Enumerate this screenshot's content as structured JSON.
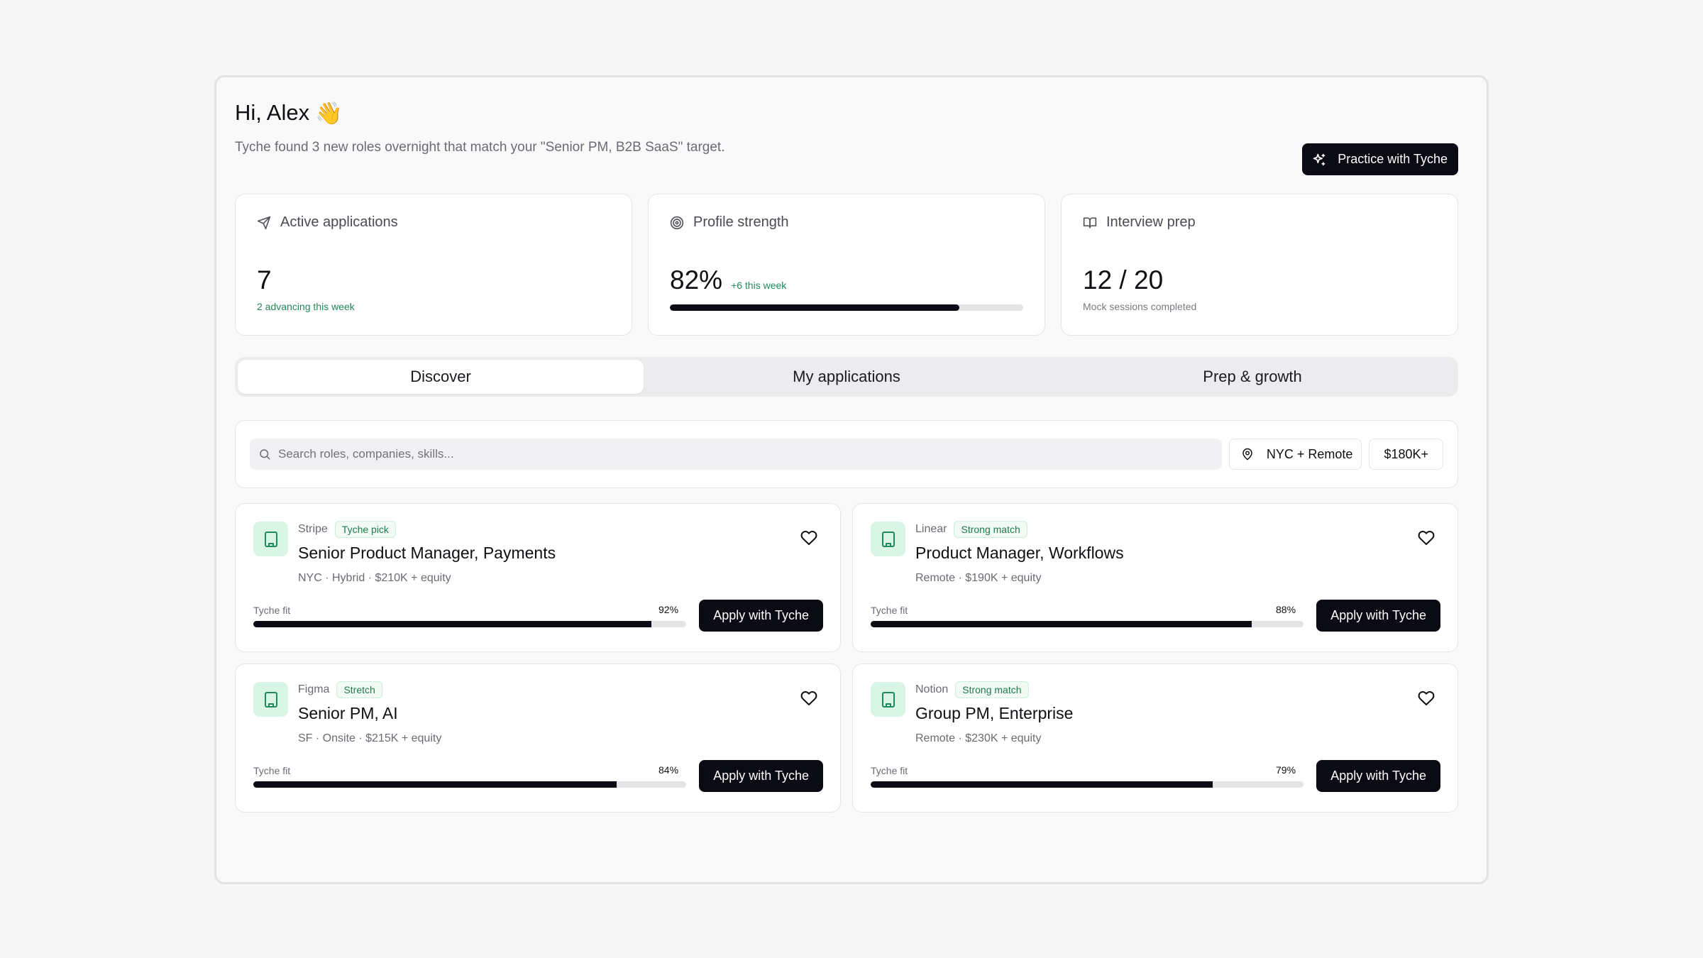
{
  "header": {
    "greeting": "Hi, Alex",
    "greeting_emoji": "👋",
    "subtitle": "Tyche found 3 new roles overnight that match your \"Senior PM, B2B SaaS\" target.",
    "practice_label": "Practice with Tyche"
  },
  "stats": [
    {
      "icon": "send-icon",
      "label": "Active applications",
      "value": "7",
      "note": "2 advancing this week"
    },
    {
      "icon": "target-icon",
      "label": "Profile strength",
      "value": "82%",
      "delta": "+6 this week",
      "progress": 0.82
    },
    {
      "icon": "book-icon",
      "label": "Interview prep",
      "value": "12 / 20",
      "note": "Mock sessions completed"
    }
  ],
  "tabs": [
    {
      "label": "Discover",
      "active": true
    },
    {
      "label": "My applications",
      "active": false
    },
    {
      "label": "Prep & growth",
      "active": false
    }
  ],
  "search": {
    "placeholder": "Search roles, companies, skills...",
    "location_filter": "NYC + Remote",
    "salary_filter": "$180K+"
  },
  "jobs": [
    {
      "company": "Stripe",
      "badge": "Tyche pick",
      "title": "Senior Product Manager, Payments",
      "details": "NYC · Hybrid · $210K + equity",
      "fit_label": "Tyche fit",
      "fit": "92%",
      "fit_value": 0.92,
      "apply_label": "Apply with Tyche"
    },
    {
      "company": "Linear",
      "badge": "Strong match",
      "title": "Product Manager, Workflows",
      "details": "Remote · $190K + equity",
      "fit_label": "Tyche fit",
      "fit": "88%",
      "fit_value": 0.88,
      "apply_label": "Apply with Tyche"
    },
    {
      "company": "Figma",
      "badge": "Stretch",
      "title": "Senior PM, AI",
      "details": "SF · Onsite · $215K + equity",
      "fit_label": "Tyche fit",
      "fit": "84%",
      "fit_value": 0.84,
      "apply_label": "Apply with Tyche"
    },
    {
      "company": "Notion",
      "badge": "Strong match",
      "title": "Group PM, Enterprise",
      "details": "Remote · $230K + equity",
      "fit_label": "Tyche fit",
      "fit": "79%",
      "fit_value": 0.79,
      "apply_label": "Apply with Tyche"
    }
  ],
  "colors": {
    "accent": "#0b0b14",
    "success": "#1f8a5a",
    "badge_bg": "#f1faf4",
    "logo_bg": "#d9f5e6"
  }
}
